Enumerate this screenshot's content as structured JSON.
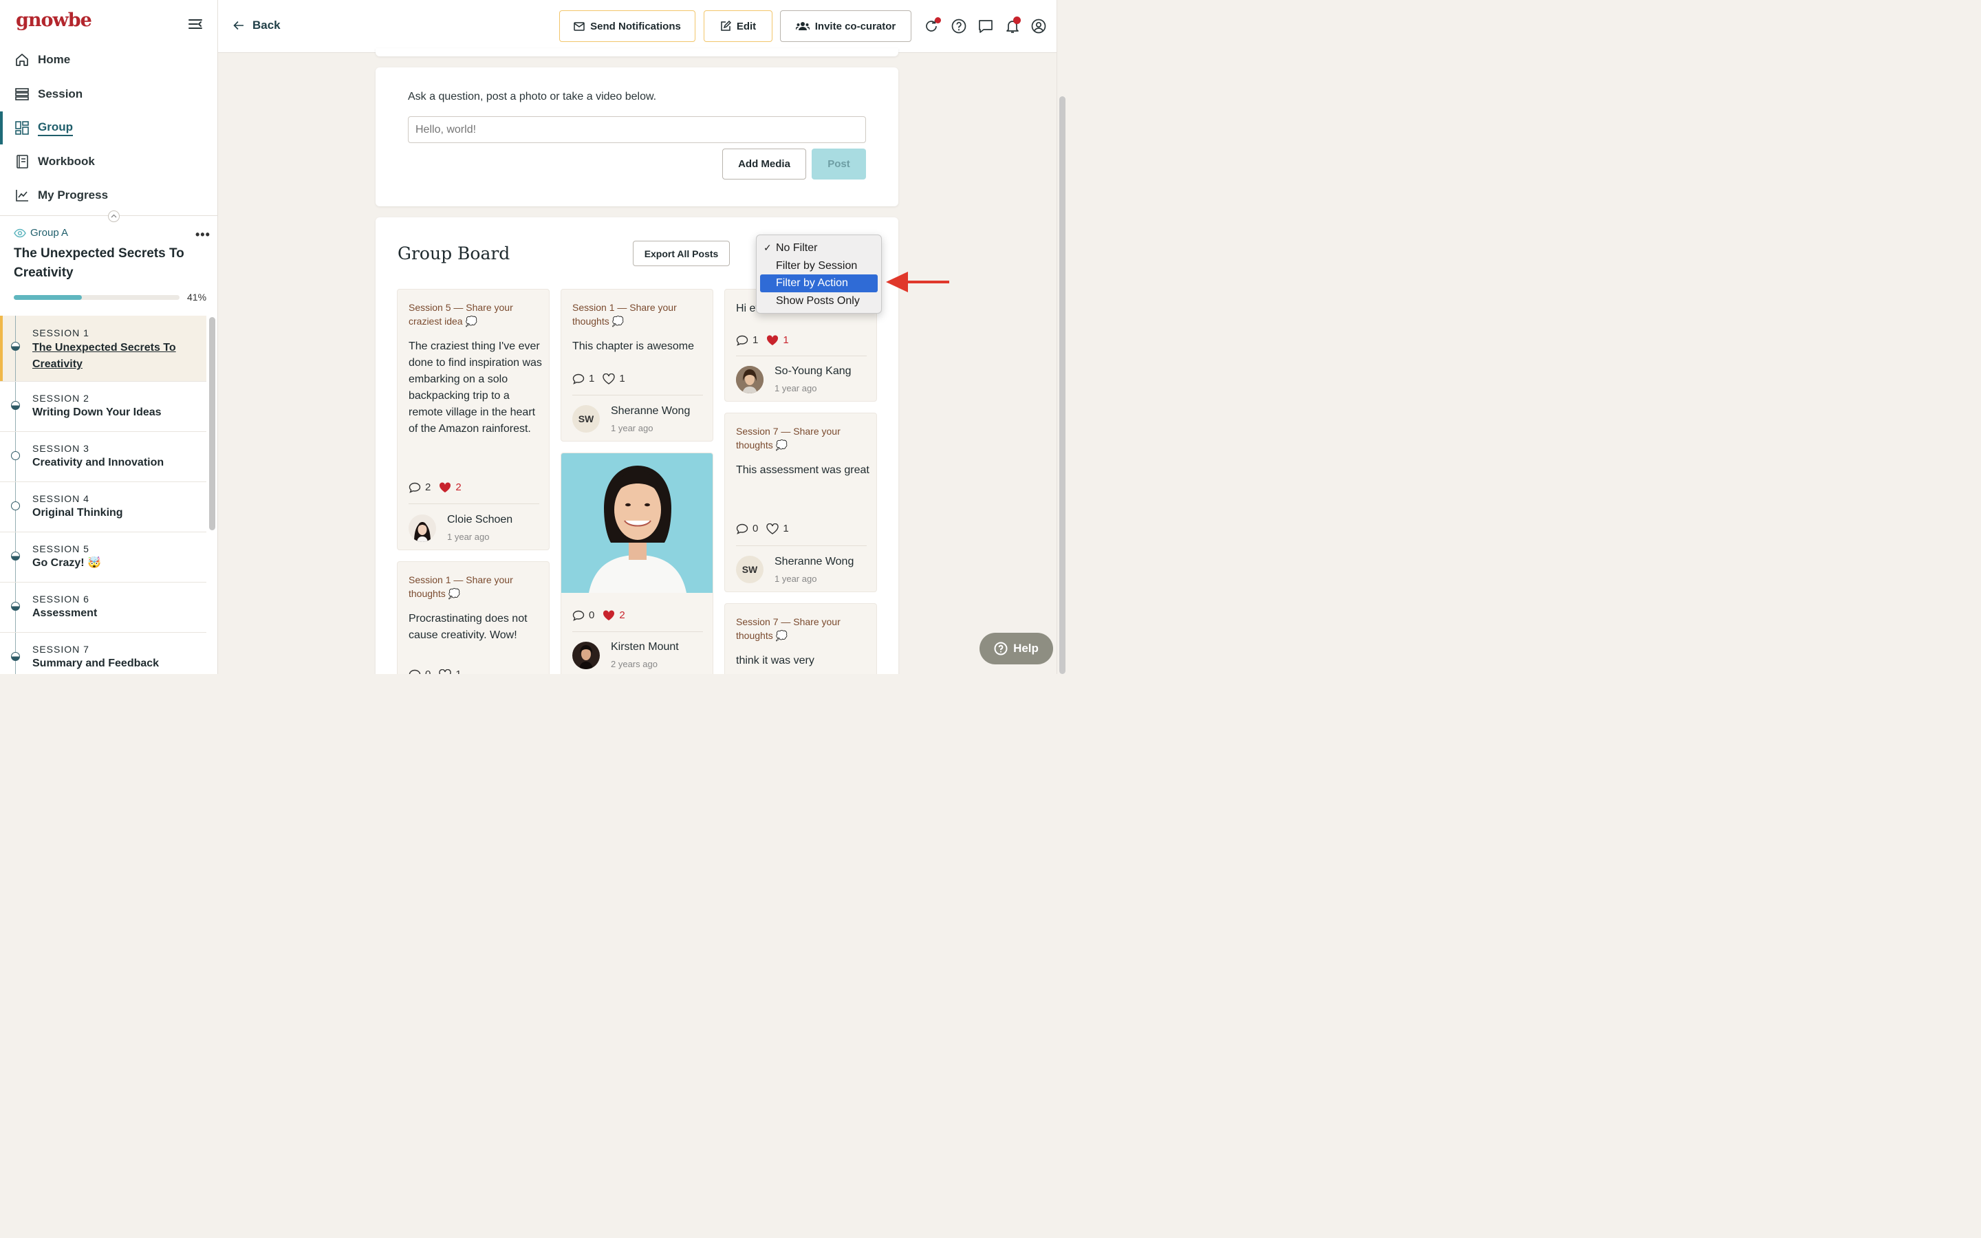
{
  "app": {
    "logo": "gnowbe"
  },
  "nav": [
    {
      "label": "Home",
      "icon": "home-icon"
    },
    {
      "label": "Session",
      "icon": "session-list-icon"
    },
    {
      "label": "Group",
      "icon": "group-board-icon",
      "active": true
    },
    {
      "label": "Workbook",
      "icon": "workbook-icon"
    },
    {
      "label": "My Progress",
      "icon": "progress-chart-icon"
    }
  ],
  "course": {
    "group": "Group A",
    "title": "The Unexpected Secrets To Creativity",
    "progress": 0.41,
    "progress_label": "41%"
  },
  "sessions": [
    {
      "num": "SESSION 1",
      "title": "The Unexpected Secrets To Creativity",
      "state": "half",
      "current": true
    },
    {
      "num": "SESSION 2",
      "title": "Writing Down Your Ideas",
      "state": "half"
    },
    {
      "num": "SESSION 3",
      "title": "Creativity and Innovation",
      "state": "empty"
    },
    {
      "num": "SESSION 4",
      "title": "Original Thinking",
      "state": "empty"
    },
    {
      "num": "SESSION 5",
      "title": "Go Crazy! 🤯",
      "state": "half"
    },
    {
      "num": "SESSION 6",
      "title": "Assessment",
      "state": "half"
    },
    {
      "num": "SESSION 7",
      "title": "Summary and Feedback",
      "state": "half"
    }
  ],
  "header": {
    "back": "Back",
    "send": "Send Notifications",
    "edit": "Edit",
    "invite": "Invite co-curator"
  },
  "composer": {
    "prompt": "Ask a question, post a photo or take a video below.",
    "placeholder": "Hello, world!",
    "add_media": "Add Media",
    "post": "Post"
  },
  "board": {
    "title": "Group Board",
    "export": "Export All Posts"
  },
  "filter": {
    "options": [
      "No Filter",
      "Filter by Session",
      "Filter by Action",
      "Show Posts Only"
    ],
    "checked": "No Filter",
    "highlighted": "Filter by Action"
  },
  "posts": [
    {
      "session": "Session 5 — Share your craziest idea 💭",
      "body": "The craziest thing I've ever done to find inspiration was embarking on a solo backpacking trip to a remote village in the heart of the Amazon rainforest.",
      "comments": "2",
      "likes": "2",
      "liked": true,
      "author": "Cloie Schoen",
      "time": "1 year ago"
    },
    {
      "session": "Session 1 — Share your thoughts 💭",
      "body": "Procrastinating does not cause creativity. Wow!",
      "comments": "0",
      "likes": "1"
    },
    {
      "session": "Session 1 — Share your thoughts 💭",
      "body": "This chapter is awesome",
      "comments": "1",
      "likes": "1",
      "liked": false,
      "author": "Sheranne Wong",
      "initials": "SW",
      "time": "1 year ago"
    },
    {
      "comments": "0",
      "likes": "2",
      "liked": true,
      "author": "Kirsten Mount",
      "time": "2 years ago"
    },
    {
      "body": "Hi ev",
      "comments": "1",
      "likes": "1",
      "liked": true,
      "author": "So-Young Kang",
      "time": "1 year ago"
    },
    {
      "session": "Session 7 — Share your thoughts 💭",
      "body": "This assessment was great",
      "comments": "0",
      "likes": "1",
      "liked": false,
      "author": "Sheranne Wong",
      "initials": "SW",
      "time": "1 year ago"
    },
    {
      "session": "Session 7 — Share your thoughts 💭",
      "body": "think it was very"
    }
  ],
  "help": "Help",
  "colors": {
    "brand": "#b3262d",
    "accent": "#1f5e6b",
    "progress": "#5fb6bf",
    "highlight": "#2f6bd6",
    "arrow": "#e0382b"
  }
}
